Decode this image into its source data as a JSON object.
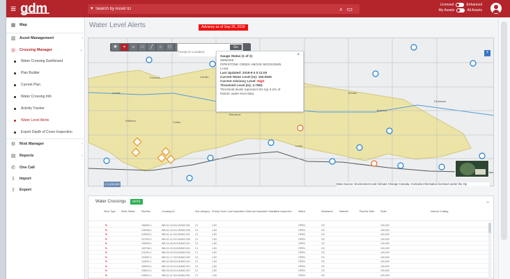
{
  "topbar": {
    "logo": "gdm",
    "search_prefix": "▾",
    "search_placeholder": "Search by Asset ID",
    "licensed_label": "Licensed",
    "enhanced_label": "Enhanced",
    "my_assets_label": "My Assets",
    "all_assets_label": "All Assets"
  },
  "sidebar": {
    "map": "Map",
    "asset_management": "Asset Management",
    "crossing_manager": "Crossing Manager",
    "sub_items": [
      "Water Crossing Dashboard",
      "Plan Builder",
      "Current Plan",
      "Water Crossing Info",
      "Activity Tracker",
      "Water Level Alerts",
      "Export Depth of Cover Inspection"
    ],
    "risk_manager": "Risk Manager",
    "reports": "Reports",
    "one_call": "One Call",
    "import": "Import",
    "export": "Export"
  },
  "page": {
    "title": "Water Level Alerts",
    "advisory": "Advisory as of Sep 25, 2018"
  },
  "map_toolbar": {
    "search_placeholder": "Jump to Location",
    "search_button": "Go"
  },
  "popup": {
    "title": "Gauge Status (1 of 2)",
    "code": "05NE005",
    "name_line1": "PIPESTONE CREEK ABOVE MOOSOMIN",
    "name_line2": "LAKE",
    "updated": "Last Updated: 2018-9-4 0:11:00",
    "current_level": "Current Water Level (m): 150.0540",
    "advisory_prefix": "Current Advisory Level:",
    "advisory_value": "High",
    "threshold": "Threshold Level (m): 2.7984",
    "note1": "Threshold levels represent the top 0.2% of",
    "note2": "historic water level data."
  },
  "map": {
    "zoom_label": "1:1,400,000",
    "attribution": "Data Source: Environment and Climate Change Canada, Contains information licensed under the Op",
    "place_labels": [
      "Lindell",
      "Colfax",
      "Tioga",
      "Beulah",
      "Brawley",
      "Williston",
      "Bismarck",
      "Frenock",
      "Creslin",
      "Lewis",
      "Dickinson"
    ]
  },
  "crossings": {
    "title": "Water Crossings",
    "badge": "NOTE",
    "headers": [
      "Work Type",
      "Work Status",
      "Pipeline",
      "Crossing ID",
      "Sub category",
      "Priority Score",
      "Last Inspection Date",
      "Last Inspection Status",
      "Next Inspection",
      "Status",
      "Substance",
      "Material",
      "Pipeline Date",
      "Scale",
      "Internal Coating"
    ],
    "rows": [
      [
        "185082-1",
        "WB-01-16-011-W4M2-001",
        "C1",
        "1.83",
        "OPEN",
        "OC",
        "100,000"
      ],
      [
        "235006-1",
        "WB-01-16-012-W4M2-006",
        "C1",
        "1.83",
        "OPEN",
        "OC",
        "100,000"
      ],
      [
        "245003-1",
        "WB-01-11-013-W3M2-001",
        "C1",
        "1.83",
        "OPEN",
        "OC",
        "100,000"
      ],
      [
        "247002-1",
        "WB-01-11-013-W4M2-005",
        "C1",
        "1.83",
        "OPEN",
        "OC",
        "100,000"
      ],
      [
        "195006-1",
        "WB-04-18-013-W4M2-001",
        "C1",
        "1.83",
        "OPEN",
        "OC",
        "100,000"
      ],
      [
        "160748-1",
        "WB-01-20-015-W3M2-001",
        "C1",
        "1.83",
        "OPEN",
        "OC",
        "100,000"
      ],
      [
        "211020-1",
        "WB-00-16-015-W4M2-003",
        "C1",
        "1.83",
        "OPEN",
        "OC",
        "100,000"
      ],
      [
        "193001-1",
        "WB-01-17-023-W4M2-002",
        "C1",
        "1.83",
        "OPEN",
        "OC",
        "100,000"
      ],
      [
        "118220-1",
        "WB-02-05-013-W4M2-001",
        "C1",
        "1.83",
        "OPEN",
        "OC",
        "100,000"
      ],
      [
        "185003-1",
        "WB-03-15-013-W4M2-001",
        "C1",
        "1.83",
        "OPEN",
        "OC",
        "100,000"
      ],
      [
        "208014-1",
        "WB-09-16-013-W4M2-001",
        "C1",
        "1.83",
        "OPEN",
        "OC",
        "100,000"
      ],
      [
        "245011-1",
        "WB-01-11-019-W4M2-001",
        "C1",
        "1.83",
        "OPEN",
        "OC",
        "100,000"
      ]
    ]
  },
  "colors": {
    "brand": "#b3242b",
    "map_region": "#ece4a7",
    "map_region_border": "#d3c77d"
  }
}
